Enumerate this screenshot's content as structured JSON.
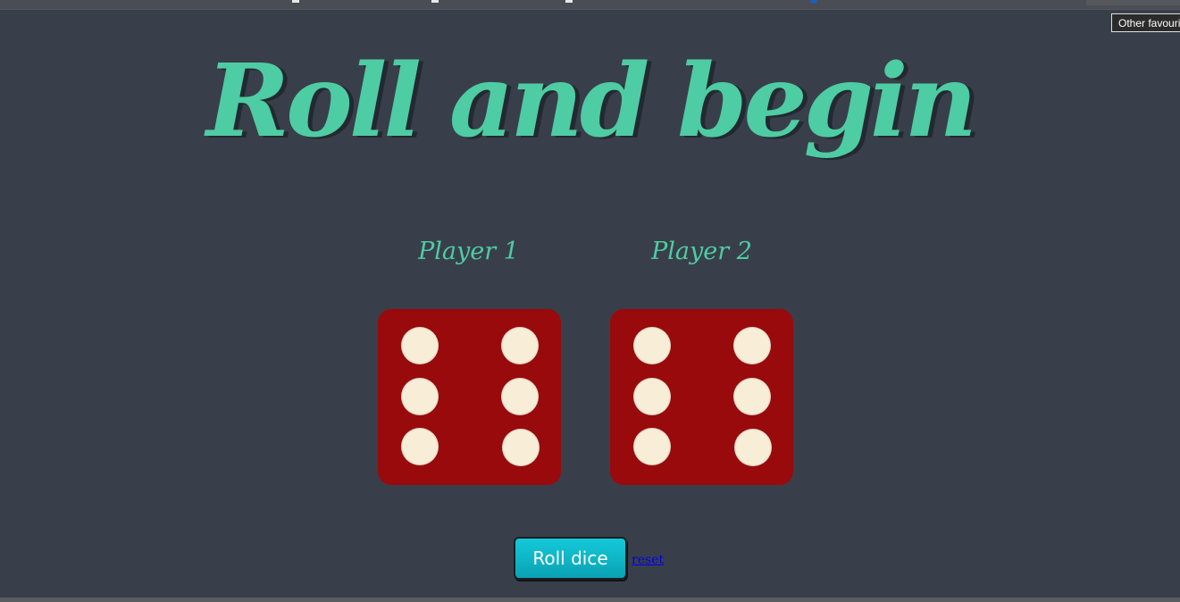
{
  "browser": {
    "tooltip_text": "Other favourites"
  },
  "game": {
    "title": "Roll and begin",
    "players": [
      {
        "label": "Player 1",
        "die_value": 6
      },
      {
        "label": "Player 2",
        "die_value": 6
      }
    ],
    "roll_button_label": "Roll dice",
    "reset_link_label": "reset"
  },
  "colors": {
    "background": "#393f4a",
    "accent": "#4ecca3",
    "die_face": "#990a0d",
    "pip": "#f8eed8",
    "button": "#0fb5c6"
  }
}
